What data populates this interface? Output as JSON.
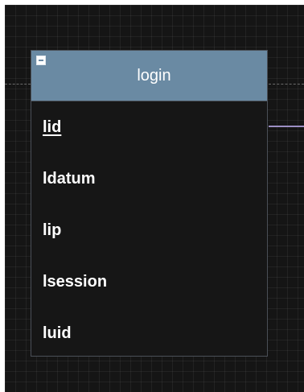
{
  "entity": {
    "title": "login",
    "attributes": [
      {
        "name": "lid",
        "primary_key": true
      },
      {
        "name": "ldatum",
        "primary_key": false
      },
      {
        "name": "lip",
        "primary_key": false
      },
      {
        "name": "lsession",
        "primary_key": false
      },
      {
        "name": "luid",
        "primary_key": false
      }
    ],
    "header_color": "#6a8aa3",
    "relation_color": "#9d8fc4"
  },
  "icons": {
    "collapse": "minus-square-icon"
  }
}
